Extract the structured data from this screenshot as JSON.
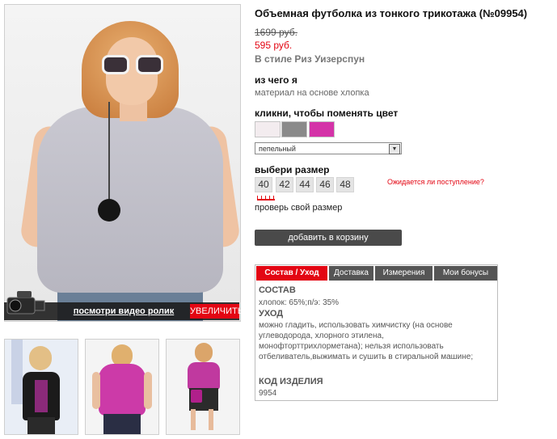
{
  "product": {
    "title": "Объемная футболка из тонкого трикотажа (№09954)",
    "old_price": "1699 руб.",
    "new_price": "595 руб.",
    "style": "В стиле Риз Уизерспун"
  },
  "material": {
    "heading": "из чего я",
    "text": "материал на основе хлопка"
  },
  "colors": {
    "heading": "кликни, чтобы поменять цвет",
    "swatches": [
      {
        "name": "white",
        "hex": "#f3ecef"
      },
      {
        "name": "grey",
        "hex": "#8a8a8a"
      },
      {
        "name": "fuchsia",
        "hex": "#d433a8"
      }
    ],
    "selected": "пепельный"
  },
  "sizes": {
    "heading": "выбери размер",
    "options": [
      "40",
      "42",
      "44",
      "46",
      "48"
    ],
    "expect_link": "Ожидается ли поступление?",
    "check_link": "проверь свой размер"
  },
  "cart_button": "добавить в корзину",
  "photo": {
    "video_link": "посмотри видео ролик",
    "enlarge": "УВЕЛИЧИТЬ"
  },
  "tabs": {
    "labels": [
      "Состав / Уход",
      "Доставка",
      "Измерения",
      "Мои бонусы"
    ],
    "active": "Состав / Уход"
  },
  "details": {
    "composition_heading": "СОСТАВ",
    "composition_text": "хлопок: 65%;п/э: 35%",
    "care_heading": "УХОД",
    "care_text": "можно гладить, использовать химчистку (на основе углеводорода, хлорного этилена, монофторттрихлорметана); нельзя использовать отбеливатель,выжимать и сушить в стиральной машине;",
    "code_heading": "КОД ИЗДЕЛИЯ",
    "code_value": "9954"
  },
  "accent_color": "#e30613"
}
